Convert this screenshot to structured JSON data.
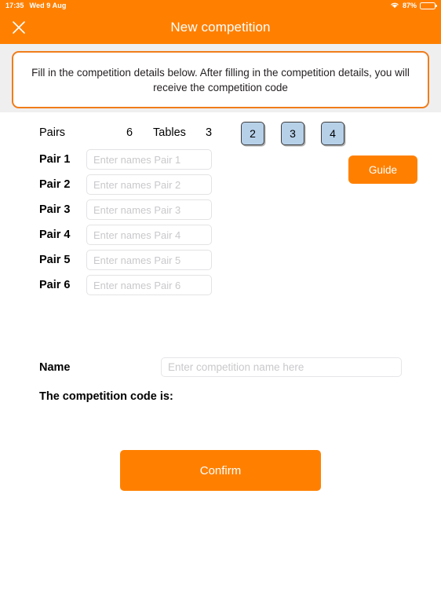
{
  "status_bar": {
    "time": "17:35",
    "date": "Wed 9 Aug",
    "battery_percent": "87%",
    "wifi_icon": "wifi-icon",
    "battery_icon": "battery-icon"
  },
  "nav": {
    "title": "New competition",
    "close_icon": "close-icon"
  },
  "banner": {
    "text": "Fill in the competition details below. After filling in the competition details, you will receive the competition code"
  },
  "counts": {
    "pairs_label": "Pairs",
    "pairs_value": "6",
    "tables_label": "Tables",
    "tables_value": "3",
    "table_options": [
      "2",
      "3",
      "4"
    ]
  },
  "pairs": [
    {
      "label": "Pair 1",
      "value": "",
      "placeholder": "Enter names Pair 1"
    },
    {
      "label": "Pair 2",
      "value": "",
      "placeholder": "Enter names Pair 2"
    },
    {
      "label": "Pair 3",
      "value": "",
      "placeholder": "Enter names Pair 3"
    },
    {
      "label": "Pair 4",
      "value": "",
      "placeholder": "Enter names Pair 4"
    },
    {
      "label": "Pair 5",
      "value": "",
      "placeholder": "Enter names Pair 5"
    },
    {
      "label": "Pair 6",
      "value": "",
      "placeholder": "Enter names Pair 6"
    }
  ],
  "guide": {
    "label": "Guide"
  },
  "name_field": {
    "label": "Name",
    "value": "",
    "placeholder": "Enter competition name here"
  },
  "competition_code": {
    "label": "The competition code is:",
    "value": ""
  },
  "confirm": {
    "label": "Confirm"
  },
  "colors": {
    "brand_orange": "#ff8000",
    "banner_border": "#f07d1a",
    "strip_gray": "#efeff0",
    "button_blue": "#b6d0e8",
    "button_blue_border": "#3c3c3c",
    "input_border": "#e3e3e5",
    "placeholder": "#c9c9cc"
  }
}
